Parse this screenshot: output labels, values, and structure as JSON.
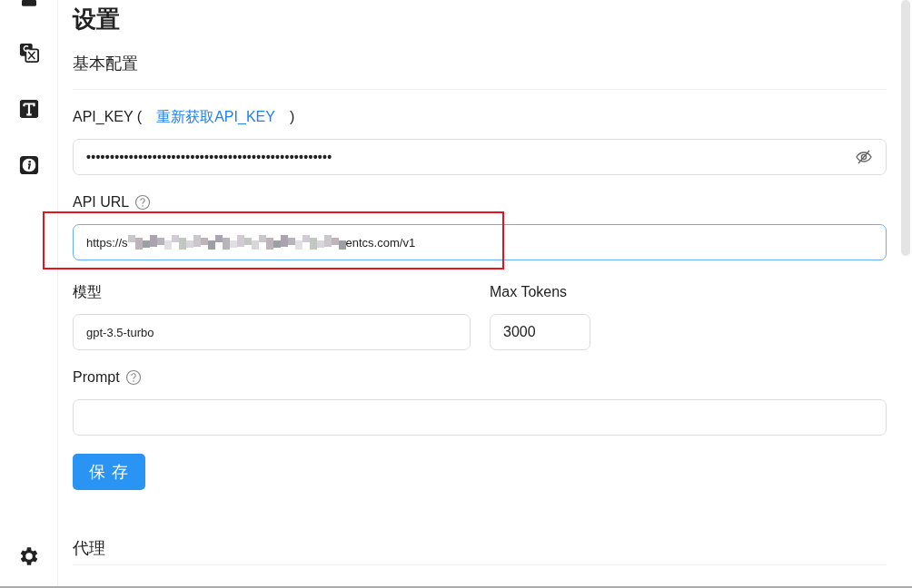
{
  "title": "设置",
  "section": "基本配置",
  "api_key": {
    "label": "API_KEY (",
    "link": "重新获取API_KEY",
    "label_end": ")",
    "value": "••••••••••••••••••••••••••••••••••••••••••••••••••••",
    "masked": true
  },
  "api_url": {
    "label": "API URL",
    "value_start": "https://s",
    "value_end": "entcs.com/v1",
    "focused": true,
    "highlighted": true
  },
  "model": {
    "label": "模型",
    "value": "gpt-3.5-turbo"
  },
  "max_tokens": {
    "label": "Max Tokens",
    "value": "3000"
  },
  "prompt": {
    "label": "Prompt"
  },
  "save_button": "保 存",
  "next_section": "代理"
}
